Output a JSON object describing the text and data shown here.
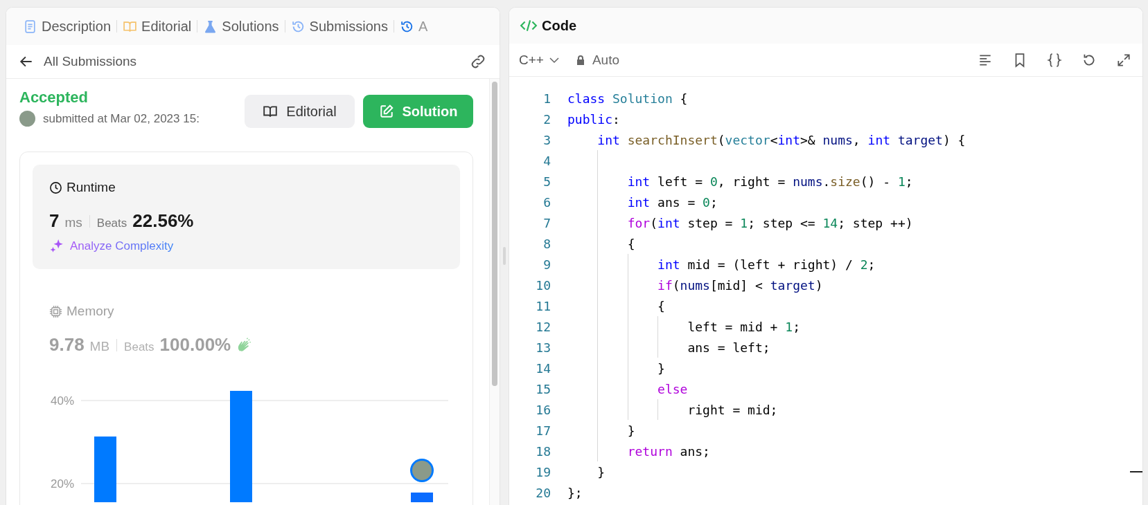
{
  "left_panel": {
    "tabs": [
      {
        "label": "Description",
        "selected": false
      },
      {
        "label": "Editorial",
        "selected": false
      },
      {
        "label": "Solutions",
        "selected": false
      },
      {
        "label": "Submissions",
        "selected": false
      },
      {
        "label": "A",
        "selected": true
      }
    ],
    "header": {
      "back_label": "All Submissions"
    },
    "submission": {
      "status": "Accepted",
      "submitted": "submitted at Mar 02, 2023 15:",
      "buttons": [
        {
          "label": "Editorial",
          "kind": "secondary"
        },
        {
          "label": "Solution",
          "kind": "primary"
        }
      ]
    },
    "metrics": [
      {
        "kind": "runtime",
        "title": "Runtime",
        "value": "7",
        "unit": "ms",
        "beats_label": "Beats",
        "percent": "22.56%",
        "selected": true,
        "link": "Analyze Complexity"
      },
      {
        "kind": "memory",
        "title": "Memory",
        "value": "9.78",
        "unit": "MB",
        "beats_label": "Beats",
        "percent": "100.00%",
        "selected": false
      }
    ],
    "histogram": {
      "axis_labels": [
        "40%",
        "20%"
      ]
    }
  },
  "code_panel": {
    "title": "Code",
    "language": "C++",
    "mode": "Auto",
    "lines": [
      {
        "n": "1",
        "tokens": [
          {
            "color": "#0000ff",
            "t": "class"
          },
          {
            "color": "#267f99",
            "t": " Solution"
          },
          {
            "color": "#000000",
            "t": " {"
          }
        ]
      },
      {
        "n": "2",
        "tokens": [
          {
            "color": "#0000ff",
            "t": "public"
          },
          {
            "color": "#000000",
            "t": ":"
          }
        ]
      },
      {
        "n": "3",
        "tokens": [
          {
            "color": "#0000ff",
            "t": "    int"
          },
          {
            "color": "#795e26",
            "t": " searchInsert"
          },
          {
            "color": "#000000",
            "t": "("
          },
          {
            "color": "#267f99",
            "t": "vector"
          },
          {
            "color": "#000000",
            "t": "<"
          },
          {
            "color": "#0000ff",
            "t": "int"
          },
          {
            "color": "#000000",
            "t": ">& "
          },
          {
            "color": "#001080",
            "t": "nums"
          },
          {
            "color": "#000000",
            "t": ", "
          },
          {
            "color": "#0000ff",
            "t": "int"
          },
          {
            "color": "#001080",
            "t": " target"
          },
          {
            "color": "#000000",
            "t": ") {"
          }
        ]
      },
      {
        "n": "4"
      },
      {
        "n": "5",
        "tokens": [
          {
            "color": "#0000ff",
            "t": "        int"
          },
          {
            "color": "#000000",
            "t": " left = "
          },
          {
            "color": "#098658",
            "t": "0"
          },
          {
            "color": "#000000",
            "t": ", right = "
          },
          {
            "color": "#001080",
            "t": "nums"
          },
          {
            "color": "#000000",
            "t": "."
          },
          {
            "color": "#795e26",
            "t": "size"
          },
          {
            "color": "#000000",
            "t": "() - "
          },
          {
            "color": "#098658",
            "t": "1"
          },
          {
            "color": "#000000",
            "t": ";"
          }
        ]
      },
      {
        "n": "6",
        "tokens": [
          {
            "color": "#0000ff",
            "t": "        int"
          },
          {
            "color": "#000000",
            "t": " ans = "
          },
          {
            "color": "#098658",
            "t": "0"
          },
          {
            "color": "#000000",
            "t": ";"
          }
        ]
      },
      {
        "n": "7",
        "tokens": [
          {
            "color": "#af00db",
            "t": "        for"
          },
          {
            "color": "#000000",
            "t": "("
          },
          {
            "color": "#0000ff",
            "t": "int"
          },
          {
            "color": "#000000",
            "t": " step = "
          },
          {
            "color": "#098658",
            "t": "1"
          },
          {
            "color": "#000000",
            "t": "; step <= "
          },
          {
            "color": "#098658",
            "t": "14"
          },
          {
            "color": "#000000",
            "t": "; step ++)"
          }
        ]
      },
      {
        "n": "8",
        "tokens": [
          {
            "color": "#000000",
            "t": "        {"
          }
        ]
      },
      {
        "n": "9",
        "tokens": [
          {
            "color": "#0000ff",
            "t": "            int"
          },
          {
            "color": "#000000",
            "t": " mid = (left + right) / "
          },
          {
            "color": "#098658",
            "t": "2"
          },
          {
            "color": "#000000",
            "t": ";"
          }
        ]
      },
      {
        "n": "10",
        "tokens": [
          {
            "color": "#af00db",
            "t": "            if"
          },
          {
            "color": "#000000",
            "t": "("
          },
          {
            "color": "#001080",
            "t": "nums"
          },
          {
            "color": "#000000",
            "t": "[mid] < "
          },
          {
            "color": "#001080",
            "t": "target"
          },
          {
            "color": "#000000",
            "t": ")"
          }
        ]
      },
      {
        "n": "11",
        "tokens": [
          {
            "color": "#000000",
            "t": "            {"
          }
        ]
      },
      {
        "n": "12",
        "tokens": [
          {
            "color": "#000000",
            "t": "                left = mid + "
          },
          {
            "color": "#098658",
            "t": "1"
          },
          {
            "color": "#000000",
            "t": ";"
          }
        ]
      },
      {
        "n": "13",
        "tokens": [
          {
            "color": "#000000",
            "t": "                ans = left;"
          }
        ]
      },
      {
        "n": "14",
        "tokens": [
          {
            "color": "#000000",
            "t": "            }"
          }
        ]
      },
      {
        "n": "15",
        "tokens": [
          {
            "color": "#af00db",
            "t": "            else"
          }
        ]
      },
      {
        "n": "16",
        "tokens": [
          {
            "color": "#000000",
            "t": "                right = mid;"
          }
        ]
      },
      {
        "n": "17",
        "tokens": [
          {
            "color": "#000000",
            "t": "        }"
          }
        ]
      },
      {
        "n": "18",
        "tokens": [
          {
            "color": "#af00db",
            "t": "        return"
          },
          {
            "color": "#000000",
            "t": " ans;"
          }
        ]
      },
      {
        "n": "19",
        "tokens": [
          {
            "color": "#000000",
            "t": "    }"
          }
        ]
      },
      {
        "n": "20",
        "tokens": [
          {
            "color": "#000000",
            "t": "};"
          }
        ]
      }
    ]
  }
}
